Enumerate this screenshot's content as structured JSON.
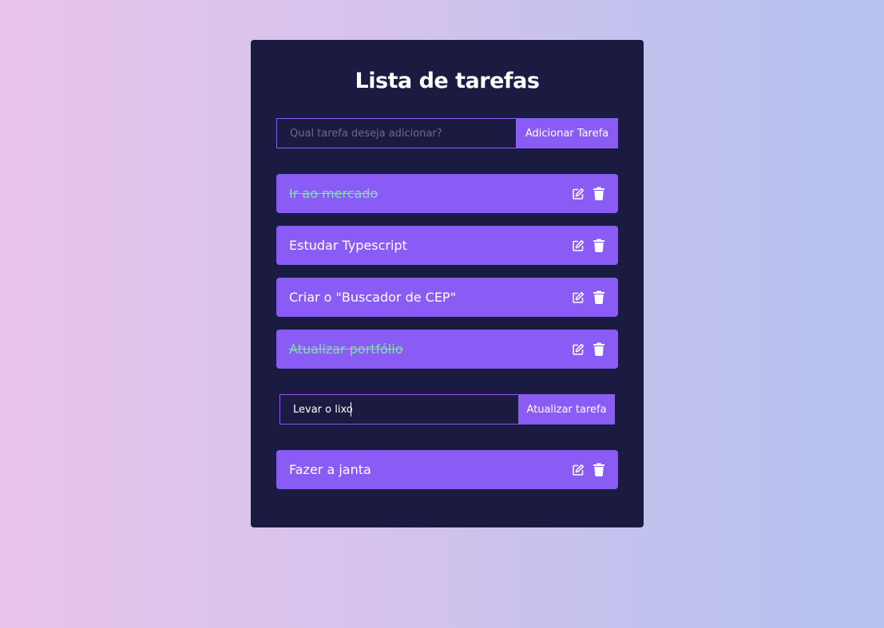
{
  "app": {
    "title": "Lista de tarefas"
  },
  "add_form": {
    "placeholder": "Qual tarefa deseja adicionar?",
    "value": "",
    "button_label": "Adicionar Tarefa"
  },
  "tasks": [
    {
      "text": "Ir ao mercado",
      "completed": true
    },
    {
      "text": "Estudar Typescript",
      "completed": false
    },
    {
      "text": "Criar o \"Buscador de CEP\"",
      "completed": false
    },
    {
      "text": "Atualizar portfólio",
      "completed": true
    },
    {
      "text": "Fazer a janta",
      "completed": false
    }
  ],
  "edit_form": {
    "value": "Levar o lixo",
    "button_label": "Atualizar tarefa"
  },
  "icons": {
    "edit": "edit-icon",
    "delete": "trash-icon"
  },
  "colors": {
    "card_background": "#1b1b42",
    "accent": "#8a5cf5",
    "completed_text": "#7fe0a8",
    "text": "#ffffff"
  }
}
